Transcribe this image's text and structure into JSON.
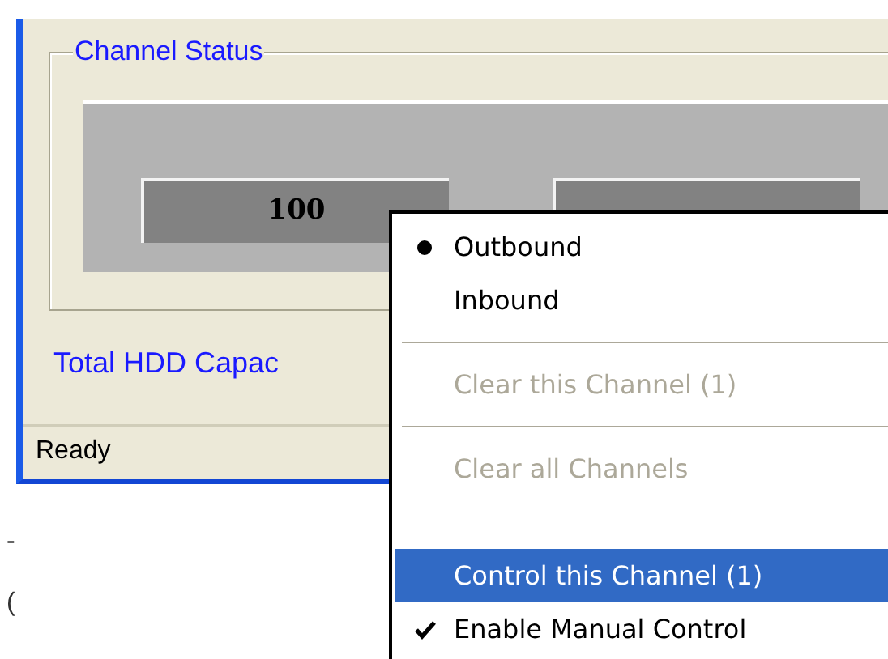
{
  "group_box": {
    "title": "Channel Status",
    "channels": [
      {
        "value": "100",
        "obscured": false
      },
      {
        "obscured": true
      }
    ]
  },
  "capacity_label": "Total HDD Capac",
  "status_bar": "Ready",
  "fragments": [
    "-",
    "("
  ],
  "context_menu": [
    {
      "kind": "radio",
      "label": "Outbound",
      "checked": true,
      "selected": false,
      "disabled": false
    },
    {
      "kind": "radio",
      "label": "Inbound",
      "checked": false,
      "selected": false,
      "disabled": false
    },
    {
      "kind": "separator"
    },
    {
      "kind": "item",
      "label": "Clear this Channel (1)",
      "selected": false,
      "disabled": true
    },
    {
      "kind": "separator"
    },
    {
      "kind": "item",
      "label": "Clear all Channels",
      "selected": false,
      "disabled": true
    },
    {
      "kind": "blank"
    },
    {
      "kind": "item",
      "label": "Control this Channel (1)",
      "selected": true,
      "disabled": false
    },
    {
      "kind": "check",
      "label": "Enable Manual Control",
      "checked": true,
      "selected": false,
      "disabled": false
    }
  ]
}
